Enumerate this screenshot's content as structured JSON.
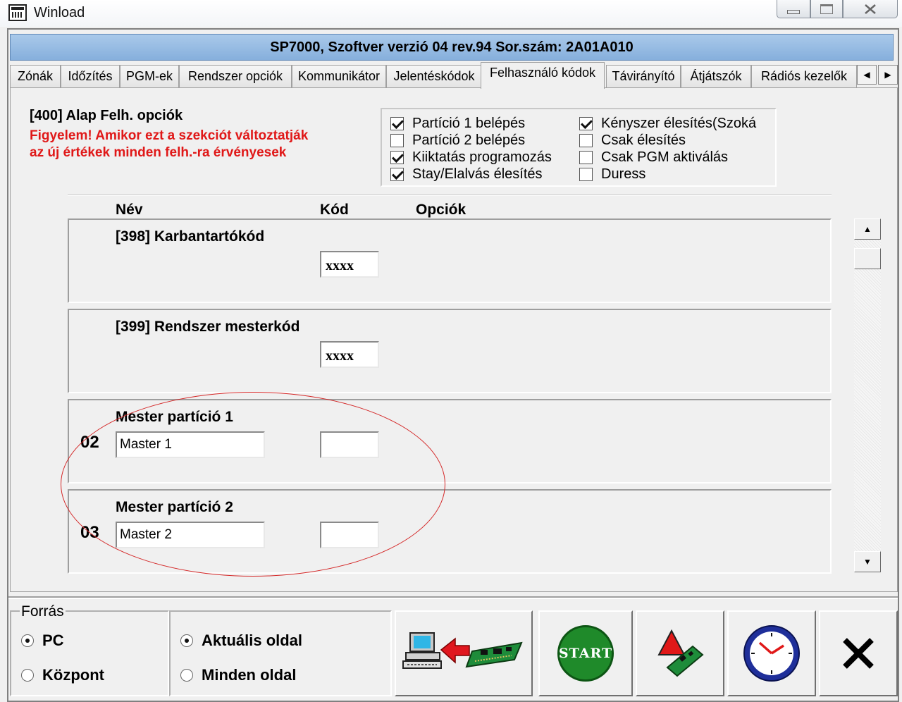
{
  "window": {
    "title": "Winload"
  },
  "header": {
    "title": "SP7000, Szoftver verzió 04 rev.94 Sor.szám: 2A01A010"
  },
  "tabs": [
    {
      "label": "Zónák",
      "active": false
    },
    {
      "label": "Időzítés",
      "active": false
    },
    {
      "label": "PGM-ek",
      "active": false
    },
    {
      "label": "Rendszer opciók",
      "active": false
    },
    {
      "label": "Kommunikátor",
      "active": false
    },
    {
      "label": "Jelentéskódok",
      "active": false
    },
    {
      "label": "Felhasználó kódok",
      "active": true
    },
    {
      "label": "Távirányító",
      "active": false
    },
    {
      "label": "Átjátszók",
      "active": false
    },
    {
      "label": "Rádiós kezelők",
      "active": false
    }
  ],
  "options_section": {
    "title": "[400] Alap Felh. opciók",
    "warning": "Figyelem! Amikor ezt a szekciót változtatják\naz új értékek minden felh.-ra érvényesek",
    "checkboxes": [
      {
        "label": "Partíció 1 belépés",
        "checked": true
      },
      {
        "label": "Partíció 2 belépés",
        "checked": false
      },
      {
        "label": "Kiiktatás programozás",
        "checked": true
      },
      {
        "label": "Stay/Elalvás élesítés",
        "checked": true
      },
      {
        "label": "Kényszer élesítés(Szoká",
        "checked": true
      },
      {
        "label": "Csak élesítés",
        "checked": false
      },
      {
        "label": "Csak PGM aktiválás",
        "checked": false
      },
      {
        "label": "Duress",
        "checked": false
      }
    ]
  },
  "columns": {
    "name": "Név",
    "code": "Kód",
    "options": "Opciók"
  },
  "users": [
    {
      "title": "[398] Karbantartókód",
      "number": "",
      "name_value": "",
      "code_value": "xxxx"
    },
    {
      "title": "[399] Rendszer mesterkód",
      "number": "",
      "name_value": "",
      "code_value": "xxxx"
    },
    {
      "title": "Mester partíció 1",
      "number": "02",
      "name_value": "Master 1",
      "code_value": ""
    },
    {
      "title": "Mester partíció 2",
      "number": "03",
      "name_value": "Master 2",
      "code_value": ""
    }
  ],
  "source_group": {
    "label": "Forrás",
    "options": [
      {
        "label": "PC",
        "selected": true
      },
      {
        "label": "Központ",
        "selected": false
      }
    ]
  },
  "page_group": {
    "options": [
      {
        "label": "Aktuális oldal",
        "selected": true
      },
      {
        "label": "Minden oldal",
        "selected": false
      }
    ]
  },
  "actions": {
    "start_label": "START"
  },
  "colors": {
    "header_bg": "#8fb4df",
    "warning": "#e01818",
    "start_green": "#1f8a2a",
    "annotation_oval": "#d42828"
  },
  "icons": [
    "app-icon",
    "minimize-icon",
    "maximize-icon",
    "close-icon",
    "tab-scroll-left-icon",
    "tab-scroll-right-icon",
    "scroll-up-icon",
    "scroll-down-icon",
    "pc-to-panel-icon",
    "panel-compare-icon",
    "clock-icon",
    "cancel-x-icon"
  ]
}
